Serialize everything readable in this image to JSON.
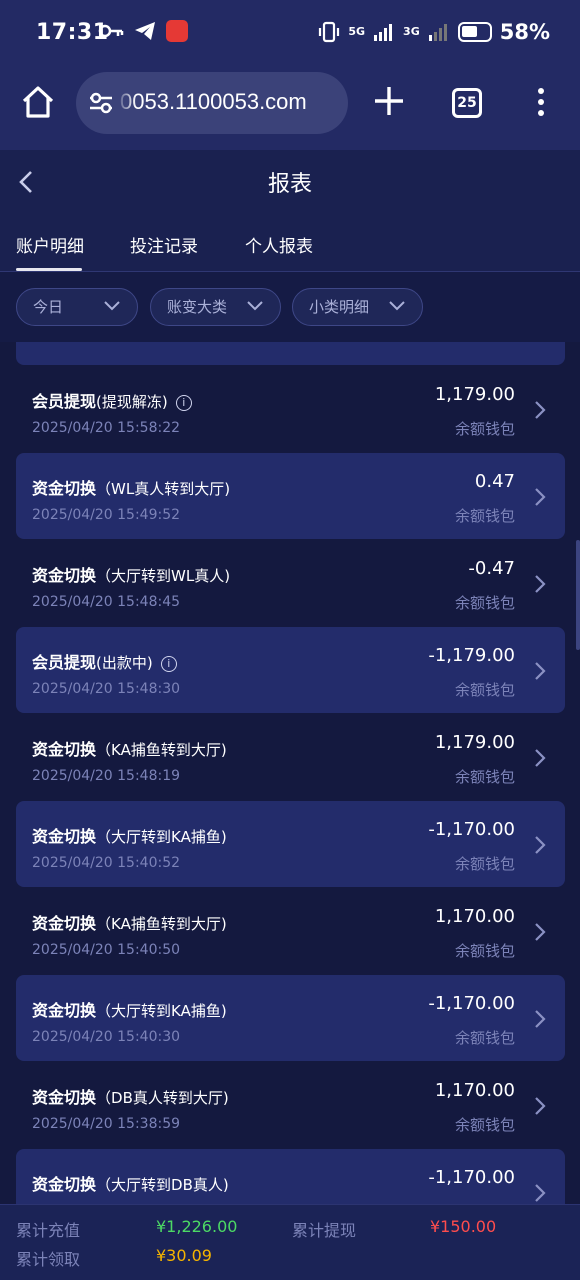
{
  "status_bar": {
    "time": "17:31",
    "net1": "5G",
    "net2": "3G",
    "battery": "58%"
  },
  "browser": {
    "url": "0053.1100053.com",
    "tab_count": "25"
  },
  "header": {
    "title": "报表"
  },
  "tabs": [
    {
      "label": "账户明细"
    },
    {
      "label": "投注记录"
    },
    {
      "label": "个人报表"
    }
  ],
  "filters": [
    {
      "label": "今日"
    },
    {
      "label": "账变大类"
    },
    {
      "label": "小类明细"
    }
  ],
  "rows": [
    {
      "title": "会员提现",
      "sub": "(提现解冻)",
      "info": true,
      "date": "2025/04/20 15:58:22",
      "amount": "1,179.00",
      "wallet": "余额钱包"
    },
    {
      "title": "资金切换",
      "sub": "（WL真人转到大厅)",
      "info": false,
      "date": "2025/04/20 15:49:52",
      "amount": "0.47",
      "wallet": "余额钱包"
    },
    {
      "title": "资金切换",
      "sub": "（大厅转到WL真人)",
      "info": false,
      "date": "2025/04/20 15:48:45",
      "amount": "-0.47",
      "wallet": "余额钱包"
    },
    {
      "title": "会员提现",
      "sub": "(出款中)",
      "info": true,
      "date": "2025/04/20 15:48:30",
      "amount": "-1,179.00",
      "wallet": "余额钱包"
    },
    {
      "title": "资金切换",
      "sub": "（KA捕鱼转到大厅)",
      "info": false,
      "date": "2025/04/20 15:48:19",
      "amount": "1,179.00",
      "wallet": "余额钱包"
    },
    {
      "title": "资金切换",
      "sub": "（大厅转到KA捕鱼)",
      "info": false,
      "date": "2025/04/20 15:40:52",
      "amount": "-1,170.00",
      "wallet": "余额钱包"
    },
    {
      "title": "资金切换",
      "sub": "（KA捕鱼转到大厅)",
      "info": false,
      "date": "2025/04/20 15:40:50",
      "amount": "1,170.00",
      "wallet": "余额钱包"
    },
    {
      "title": "资金切换",
      "sub": "（大厅转到KA捕鱼)",
      "info": false,
      "date": "2025/04/20 15:40:30",
      "amount": "-1,170.00",
      "wallet": "余额钱包"
    },
    {
      "title": "资金切换",
      "sub": "（DB真人转到大厅)",
      "info": false,
      "date": "2025/04/20 15:38:59",
      "amount": "1,170.00",
      "wallet": "余额钱包"
    },
    {
      "title": "资金切换",
      "sub": "（大厅转到DB真人)",
      "info": false,
      "date": "",
      "amount": "-1,170.00",
      "wallet": ""
    }
  ],
  "footer": {
    "deposit_label": "累计充值",
    "deposit_value": "¥1,226.00",
    "withdraw_label": "累计提现",
    "withdraw_value": "¥150.00",
    "claim_label": "累计领取",
    "claim_value": "¥30.09"
  },
  "colors": {
    "background": "#14193f",
    "card": "#232c6b",
    "green": "#4cd964",
    "red": "#ff4d4d",
    "yellow": "#f5b400"
  }
}
